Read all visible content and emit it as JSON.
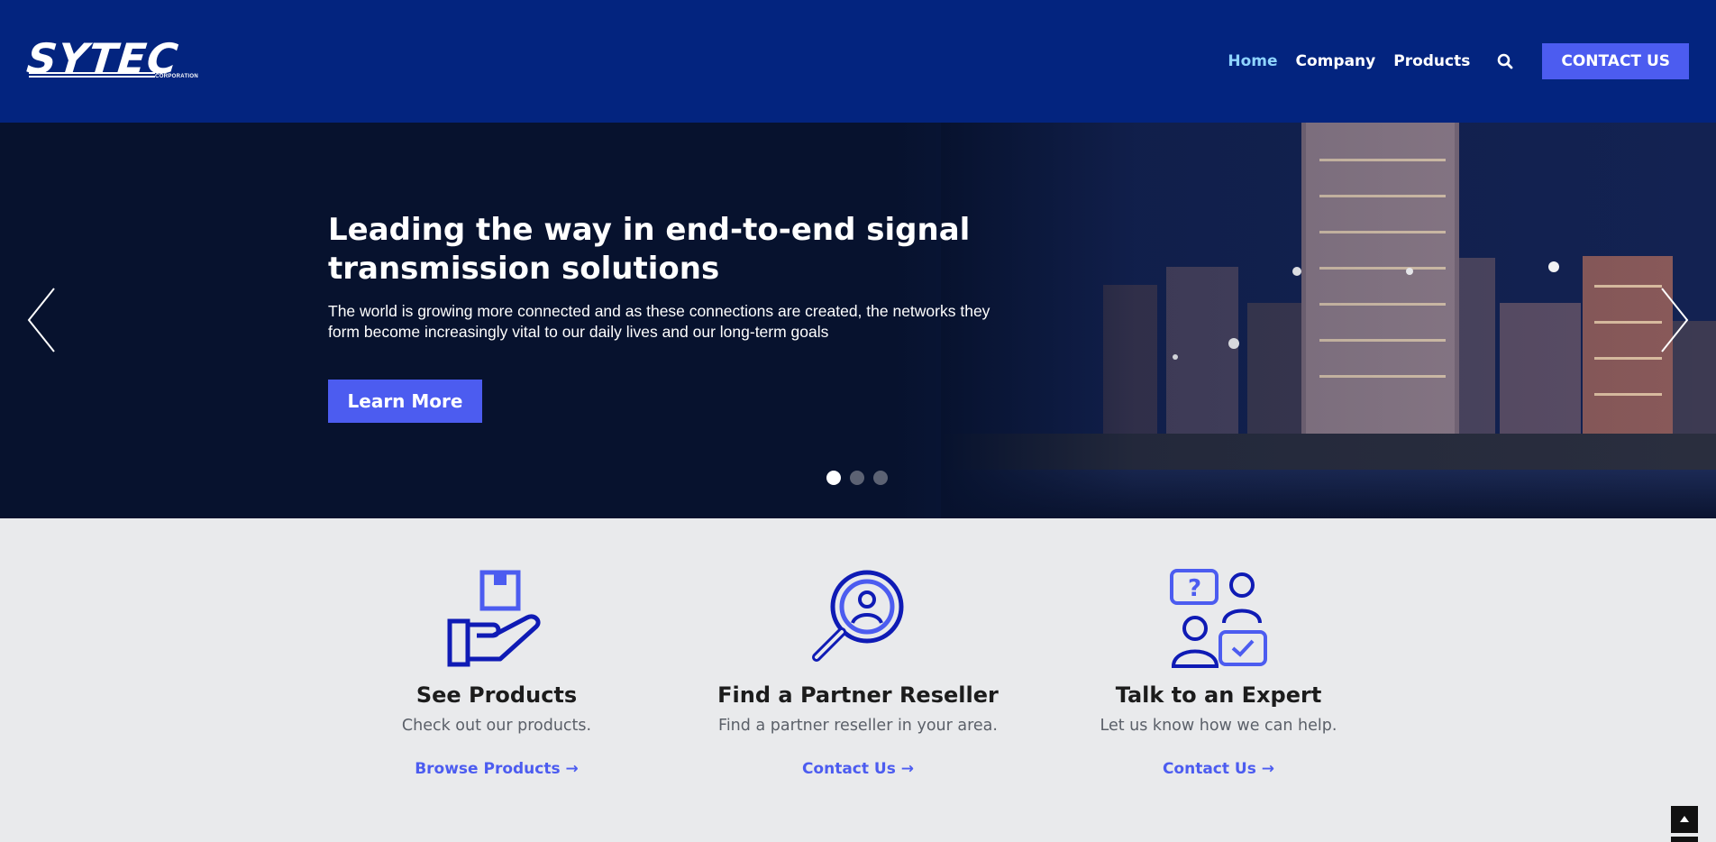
{
  "header": {
    "logo_text": "SYTEC",
    "logo_sub": "CORPORATION",
    "nav": [
      {
        "label": "Home",
        "active": true
      },
      {
        "label": "Company",
        "active": false
      },
      {
        "label": "Products",
        "active": false
      }
    ],
    "search_icon": "search-icon",
    "contact_label": "CONTACT US"
  },
  "hero": {
    "title": "Leading the way in end-to-end signal transmission solutions",
    "subtitle": "The world is growing more connected and as these connections are created, the networks they form become increasingly vital to our daily lives and our long-term goals",
    "button_label": "Learn More",
    "slides": 3,
    "active_slide": 1
  },
  "cards": [
    {
      "icon": "box-in-hand-icon",
      "title": "See Products",
      "desc": "Check out our products.",
      "link": "Browse Products →"
    },
    {
      "icon": "magnifier-person-icon",
      "title": "Find a Partner Reseller",
      "desc": "Find a partner reseller in your area.",
      "link": "Contact Us →"
    },
    {
      "icon": "experts-chat-icon",
      "title": "Talk to an Expert",
      "desc": "Let us know how we can help.",
      "link": "Contact Us →"
    }
  ],
  "colors": {
    "header_bg": "#03247f",
    "accent": "#4c5cf0",
    "nav_active": "#8fd4ff",
    "icon_dark": "#0f1bb5",
    "icon_light": "#4c5cf0"
  }
}
